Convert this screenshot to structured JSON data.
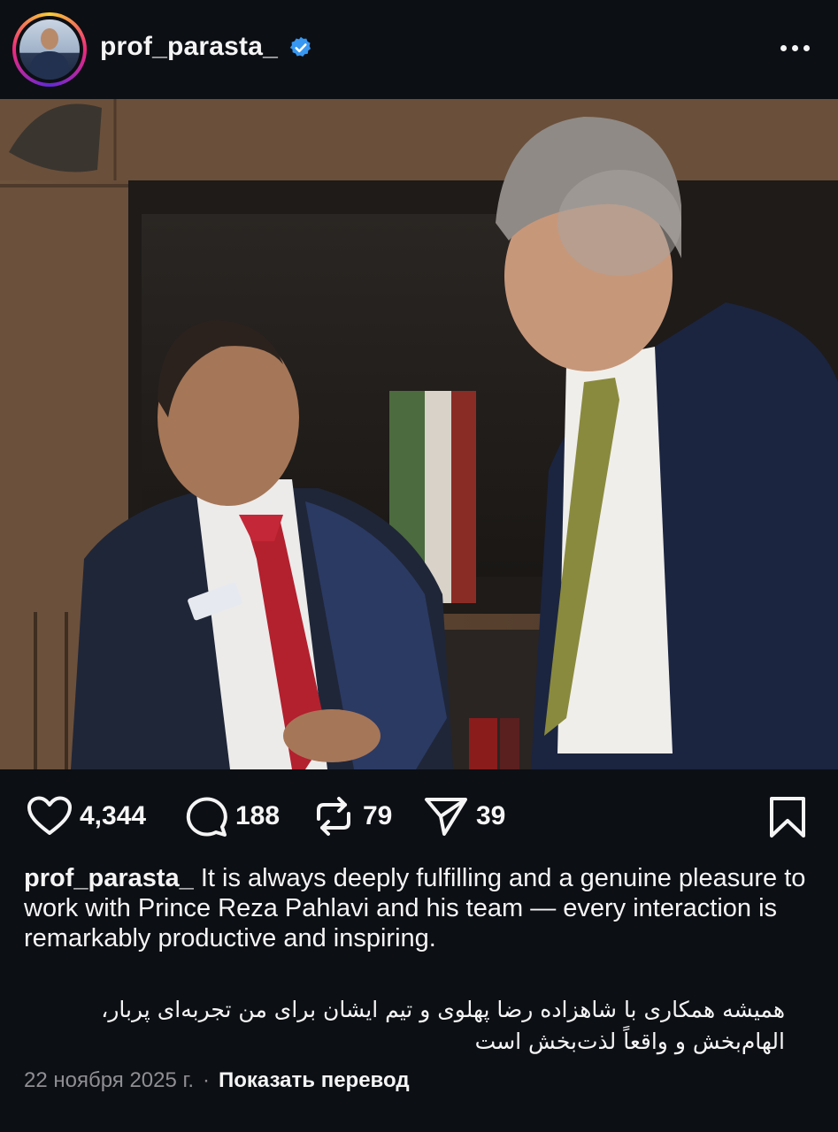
{
  "header": {
    "username": "prof_parasta_",
    "verified": true,
    "more_icon": "more-horizontal-icon"
  },
  "post": {
    "photo_alt": "photo"
  },
  "actions": {
    "likes": "4,344",
    "comments": "188",
    "reposts": "79",
    "shares": "39",
    "icons": [
      "heart-icon",
      "comment-icon",
      "repost-icon",
      "share-icon",
      "bookmark-icon"
    ]
  },
  "caption": {
    "username": "prof_parasta_",
    "text_en": " It is always deeply fulfilling and a genuine pleasure to work with Prince Reza Pahlavi and his team — every interaction is remarkably productive and inspiring.",
    "text_fa": "همیشه همکاری با شاهزاده رضا پهلوی و تیم ایشان برای من تجربه‌ای پربار، الهام‌بخش و واقعاً لذت‌بخش است"
  },
  "meta": {
    "date": "22 ноября 2025 г.",
    "separator": "·",
    "translate_label": "Показать перевод"
  },
  "colors": {
    "background": "#0c0f14",
    "text": "#f5f5f5",
    "muted": "#8e8e93",
    "verified": "#3897f0"
  }
}
